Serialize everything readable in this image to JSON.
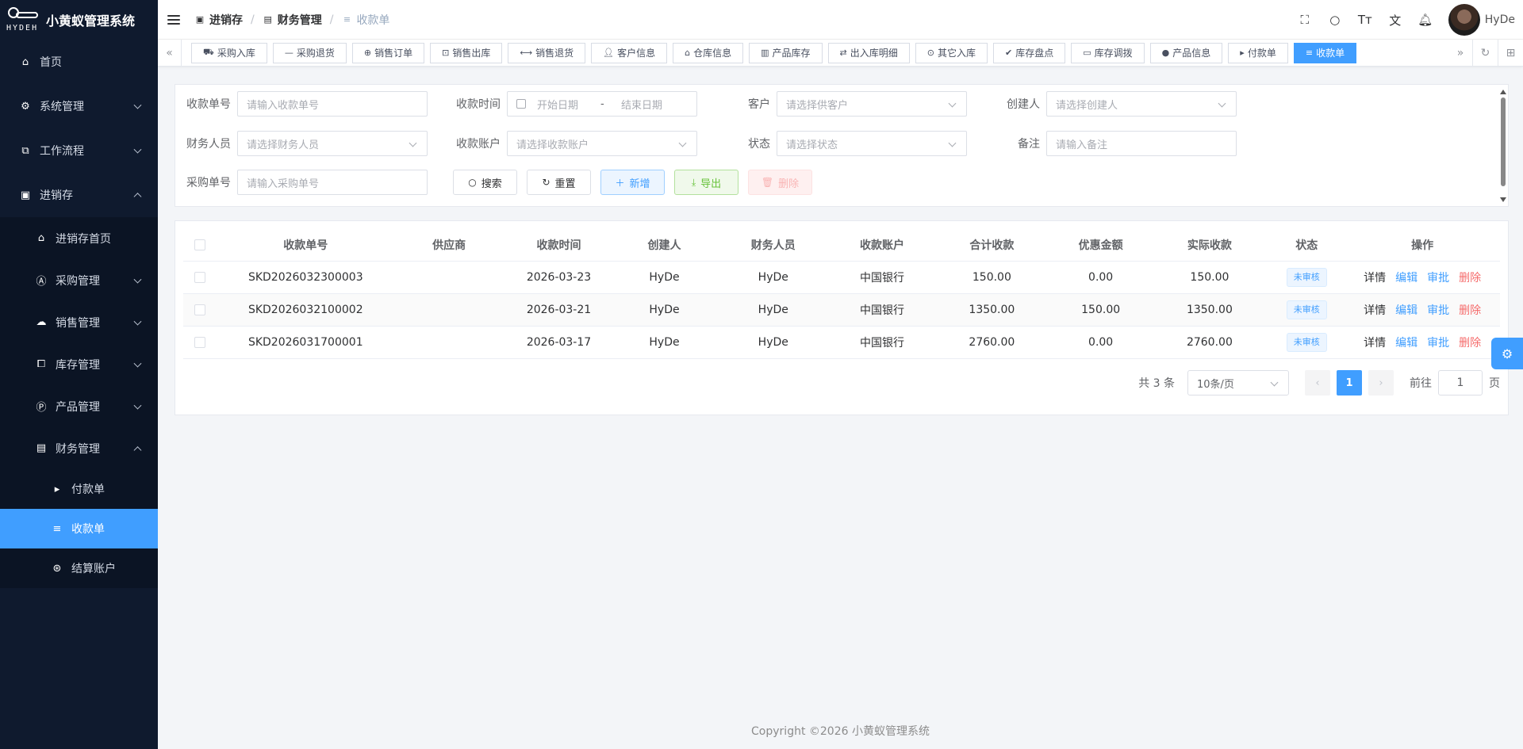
{
  "app": {
    "title": "小黄蚁管理系统",
    "brand": "HYDEH"
  },
  "sidebar": {
    "home": "首页",
    "system": "系统管理",
    "workflow": "工作流程",
    "inventory": "进销存",
    "inventory_sub": {
      "home": "进销存首页",
      "purchase": "采购管理",
      "sales": "销售管理",
      "stock": "库存管理",
      "product": "产品管理",
      "finance": "财务管理",
      "finance_sub": {
        "payment": "付款单",
        "receipt": "收款单",
        "account": "结算账户"
      }
    }
  },
  "breadcrumb": {
    "level1": "进销存",
    "level2": "财务管理",
    "level3": "收款单"
  },
  "user": {
    "name": "HyDe"
  },
  "tags": [
    "采购入库",
    "采购退货",
    "销售订单",
    "销售出库",
    "销售退货",
    "客户信息",
    "仓库信息",
    "产品库存",
    "出入库明细",
    "其它入库",
    "库存盘点",
    "库存调拨",
    "产品信息",
    "付款单",
    "收款单"
  ],
  "search": {
    "receipt_no_label": "收款单号",
    "receipt_no_ph": "请输入收款单号",
    "time_label": "收款时间",
    "start_ph": "开始日期",
    "range_sep": "-",
    "end_ph": "结束日期",
    "customer_label": "客户",
    "customer_ph": "请选择供客户",
    "creator_label": "创建人",
    "creator_ph": "请选择创建人",
    "finance_label": "财务人员",
    "finance_ph": "请选择财务人员",
    "account_label": "收款账户",
    "account_ph": "请选择收款账户",
    "status_label": "状态",
    "status_ph": "请选择状态",
    "remark_label": "备注",
    "remark_ph": "请输入备注",
    "purchase_no_label": "采购单号",
    "purchase_no_ph": "请输入采购单号",
    "btn_search": "搜索",
    "btn_reset": "重置",
    "btn_add": "新增",
    "btn_export": "导出",
    "btn_delete": "删除"
  },
  "table": {
    "headers": [
      "收款单号",
      "供应商",
      "收款时间",
      "创建人",
      "财务人员",
      "收款账户",
      "合计收款",
      "优惠金额",
      "实际收款",
      "状态",
      "操作"
    ],
    "rows": [
      {
        "no": "SKD2026032300003",
        "supplier": "",
        "time": "2026-03-23",
        "creator": "HyDe",
        "finance": "HyDe",
        "account": "中国银行",
        "total": "150.00",
        "discount": "0.00",
        "actual": "150.00",
        "status": "未审核"
      },
      {
        "no": "SKD2026032100002",
        "supplier": "",
        "time": "2026-03-21",
        "creator": "HyDe",
        "finance": "HyDe",
        "account": "中国银行",
        "total": "1350.00",
        "discount": "150.00",
        "actual": "1350.00",
        "status": "未审核"
      },
      {
        "no": "SKD2026031700001",
        "supplier": "",
        "time": "2026-03-17",
        "creator": "HyDe",
        "finance": "HyDe",
        "account": "中国银行",
        "total": "2760.00",
        "discount": "0.00",
        "actual": "2760.00",
        "status": "未审核"
      }
    ],
    "ops": {
      "detail": "详情",
      "edit": "编辑",
      "audit": "审批",
      "delete": "删除"
    }
  },
  "pagination": {
    "total": "共 3 条",
    "page_size": "10条/页",
    "current": "1",
    "goto": "前往",
    "goto_value": "1",
    "page_unit": "页"
  },
  "footer": "Copyright ©2026 小黄蚁管理系统",
  "colors": {
    "primary": "#409eff",
    "sidebar_bg": "#0f1a2e",
    "danger": "#f56c6c",
    "success": "#67c23a"
  }
}
